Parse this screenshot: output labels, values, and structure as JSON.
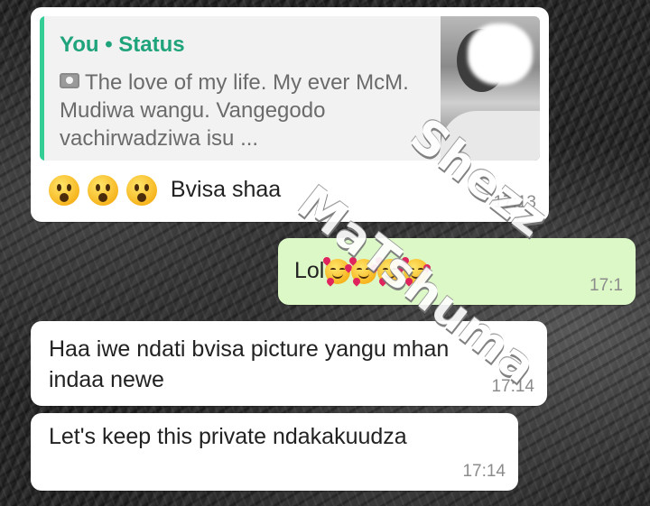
{
  "chat": {
    "messages": [
      {
        "direction": "incoming",
        "quote": {
          "author": "You • Status",
          "text": "The love of my life. My ever McM. Mudiwa wangu. Vangegodo vachirwadziwa isu ...",
          "icon": "camera-icon"
        },
        "emojis": [
          "astonished-face",
          "astonished-face",
          "astonished-face"
        ],
        "text": "Bvisa shaa",
        "time": "17:13"
      },
      {
        "direction": "outgoing",
        "text": "Lol",
        "emojis": [
          "smiling-face-with-hearts",
          "smiling-face-with-hearts",
          "smiling-face-with-hearts",
          "smiling-face-with-hearts"
        ],
        "time": "17:1"
      },
      {
        "direction": "incoming",
        "text": "Haa iwe ndati bvisa picture yangu mhan indaa newe",
        "time": "17:14"
      },
      {
        "direction": "incoming",
        "text": "Let's keep this private ndakakuudza",
        "time": "17:14"
      }
    ]
  },
  "watermark": {
    "line1": "Shezz",
    "line2": "MaTshuma"
  },
  "colors": {
    "incoming_bubble": "#ffffff",
    "outgoing_bubble": "#dcf8c6",
    "quote_author": "#1fa37b",
    "quote_bar": "#35cd96"
  }
}
